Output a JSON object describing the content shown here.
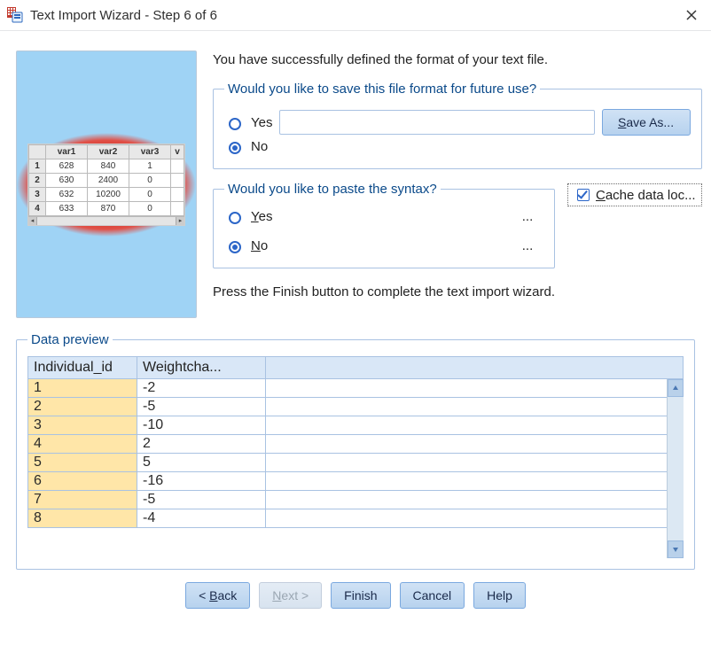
{
  "window": {
    "title": "Text Import Wizard - Step 6 of 6"
  },
  "illustration": {
    "headers": [
      "var1",
      "var2",
      "var3",
      "v"
    ],
    "rows": [
      {
        "n": "1",
        "c": [
          "628",
          "840",
          "1",
          ""
        ]
      },
      {
        "n": "2",
        "c": [
          "630",
          "2400",
          "0",
          ""
        ]
      },
      {
        "n": "3",
        "c": [
          "632",
          "10200",
          "0",
          ""
        ]
      },
      {
        "n": "4",
        "c": [
          "633",
          "870",
          "0",
          ""
        ]
      }
    ]
  },
  "messages": {
    "success": "You have successfully defined the format of your text file.",
    "press_finish": "Press the Finish button to complete the text import wizard."
  },
  "save_format": {
    "legend": "Would you like to save this file format for future use?",
    "yes_label": "Yes",
    "no_label": "No",
    "selected": "no",
    "filename": "",
    "save_as_label": "Save As..."
  },
  "paste_syntax": {
    "legend": "Would you like to paste the syntax?",
    "yes_label": "Yes",
    "no_label": "No",
    "selected": "no",
    "ellipsis": "..."
  },
  "cache": {
    "label": "Cache data loc...",
    "checked": true
  },
  "preview": {
    "legend": "Data preview",
    "columns": [
      "Individual_id",
      "Weightcha..."
    ],
    "rows": [
      {
        "id": "1",
        "w": "-2"
      },
      {
        "id": "2",
        "w": "-5"
      },
      {
        "id": "3",
        "w": "-10"
      },
      {
        "id": "4",
        "w": "2"
      },
      {
        "id": "5",
        "w": "5"
      },
      {
        "id": "6",
        "w": "-16"
      },
      {
        "id": "7",
        "w": "-5"
      },
      {
        "id": "8",
        "w": "-4"
      }
    ]
  },
  "buttons": {
    "back": "< Back",
    "next": "Next >",
    "finish": "Finish",
    "cancel": "Cancel",
    "help": "Help"
  }
}
